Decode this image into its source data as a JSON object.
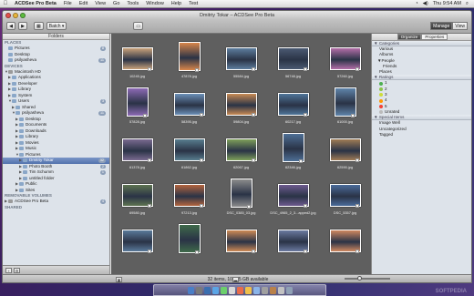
{
  "menubar": {
    "items": [
      "ACDSee Pro Beta",
      "File",
      "Edit",
      "View",
      "Go",
      "Tools",
      "Window",
      "Help",
      "Test"
    ],
    "time": "Thu 9:54 AM"
  },
  "window": {
    "title": "Dmitriy Tokar – ACDSee Pro Beta"
  },
  "toolbar": {
    "batch_label": "Batch ▾",
    "manage_label": "Manage",
    "view_label": "View"
  },
  "left": {
    "header": "Folders",
    "places_label": "PLACES",
    "devices_label": "DEVICES",
    "removable_label": "REMOVABLE VOLUMES",
    "shared_label": "SHARED",
    "rows": [
      {
        "label": "Pictures",
        "badge": "8"
      },
      {
        "label": "Desktop",
        "badge": ""
      },
      {
        "label": "psilyasheva",
        "badge": "11"
      },
      {
        "label": "Macintosh HD",
        "badge": ""
      },
      {
        "label": "Applications",
        "badge": ""
      },
      {
        "label": "Developer",
        "badge": ""
      },
      {
        "label": "Library",
        "badge": ""
      },
      {
        "label": "System",
        "badge": ""
      },
      {
        "label": "Users",
        "badge": "3"
      },
      {
        "label": "Shared",
        "badge": ""
      },
      {
        "label": "psilyasheva",
        "badge": "11"
      },
      {
        "label": "Desktop",
        "badge": ""
      },
      {
        "label": "Documents",
        "badge": ""
      },
      {
        "label": "Downloads",
        "badge": ""
      },
      {
        "label": "Library",
        "badge": ""
      },
      {
        "label": "Movies",
        "badge": ""
      },
      {
        "label": "Music",
        "badge": ""
      },
      {
        "label": "Pictures",
        "badge": ""
      },
      {
        "label": "Dmitriy Tokar",
        "badge": "32"
      },
      {
        "label": "Photo Booth",
        "badge": "2"
      },
      {
        "label": "Tim Schumm",
        "badge": "1"
      },
      {
        "label": "untitled folder",
        "badge": ""
      },
      {
        "label": "Public",
        "badge": ""
      },
      {
        "label": "Sites",
        "badge": ""
      },
      {
        "label": "ACDSee Pro Beta",
        "badge": "4"
      }
    ]
  },
  "grid": {
    "items": [
      {
        "caption": "10245.jpg",
        "color": "#c9a27a"
      },
      {
        "caption": "47878.jpg",
        "color": "#d8864a"
      },
      {
        "caption": "55584.jpg",
        "color": "#5d7e9e"
      },
      {
        "caption": "56748.jpg",
        "color": "#4b5a72"
      },
      {
        "caption": "57260.jpg",
        "color": "#b36ea8"
      },
      {
        "caption": "57828.jpg",
        "color": "#8d6ab5"
      },
      {
        "caption": "58395.jpg",
        "color": "#6b8fb8"
      },
      {
        "caption": "59804.jpg",
        "color": "#c88a54"
      },
      {
        "caption": "60217.jpg",
        "color": "#4f7599"
      },
      {
        "caption": "61000.jpg",
        "color": "#5f84aa"
      },
      {
        "caption": "61378.jpg",
        "color": "#7a6a90"
      },
      {
        "caption": "61862.jpg",
        "color": "#587e8f"
      },
      {
        "caption": "62067.jpg",
        "color": "#7ea05a"
      },
      {
        "caption": "62346.jpg",
        "color": "#4e6f96"
      },
      {
        "caption": "62590.jpg",
        "color": "#a07c55"
      },
      {
        "caption": "69580.jpg",
        "color": "#5d7350"
      },
      {
        "caption": "97213.jpg",
        "color": "#b3643e"
      },
      {
        "caption": "DSC_0385_03.jpg",
        "color": "#8c8c8c"
      },
      {
        "caption": "DSC_4965_2_3...apped2.jpg",
        "color": "#6d5a8f"
      },
      {
        "caption": "DSC_5357.jpg",
        "color": "#4a6b9a"
      },
      {
        "caption": "",
        "color": "#5a7a9a"
      },
      {
        "caption": "",
        "color": "#3f6a4a"
      },
      {
        "caption": "",
        "color": "#cf8a55"
      },
      {
        "caption": "",
        "color": "#6b7aa0"
      },
      {
        "caption": "",
        "color": "#d08860"
      }
    ]
  },
  "right": {
    "tab_organize": "Organize",
    "tab_properties": "Properties",
    "categories_label": "Categories",
    "categories": [
      "Various",
      "Albums",
      "People",
      "Friends",
      "Places"
    ],
    "ratings_label": "Ratings",
    "ratings": [
      "1",
      "2",
      "3",
      "4",
      "5",
      "Unrated"
    ],
    "rating_colors": [
      "#4caf50",
      "#8bc34a",
      "#cddc39",
      "#ff9800",
      "#f44336"
    ],
    "special_label": "Special Items",
    "special": [
      "Image Well",
      "Uncategorized",
      "Tagged"
    ]
  },
  "status": {
    "text": "32 items, 109.55 GB available"
  },
  "watermark": "SOFTPEDIA"
}
